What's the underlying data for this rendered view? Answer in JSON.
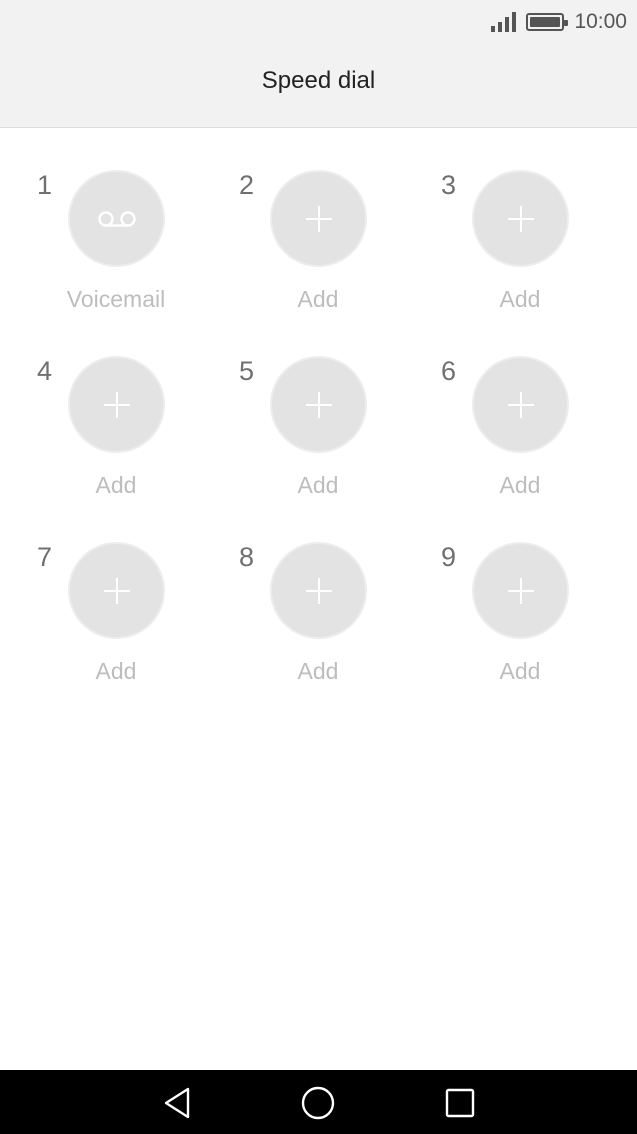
{
  "status_bar": {
    "time": "10:00"
  },
  "header": {
    "title": "Speed dial"
  },
  "speed_dial": {
    "entries": [
      {
        "number": "1",
        "label": "Voicemail",
        "icon": "voicemail-icon"
      },
      {
        "number": "2",
        "label": "Add",
        "icon": "plus-icon"
      },
      {
        "number": "3",
        "label": "Add",
        "icon": "plus-icon"
      },
      {
        "number": "4",
        "label": "Add",
        "icon": "plus-icon"
      },
      {
        "number": "5",
        "label": "Add",
        "icon": "plus-icon"
      },
      {
        "number": "6",
        "label": "Add",
        "icon": "plus-icon"
      },
      {
        "number": "7",
        "label": "Add",
        "icon": "plus-icon"
      },
      {
        "number": "8",
        "label": "Add",
        "icon": "plus-icon"
      },
      {
        "number": "9",
        "label": "Add",
        "icon": "plus-icon"
      }
    ]
  },
  "nav_bar": {
    "buttons": [
      "back-icon",
      "home-icon",
      "recents-icon"
    ]
  }
}
